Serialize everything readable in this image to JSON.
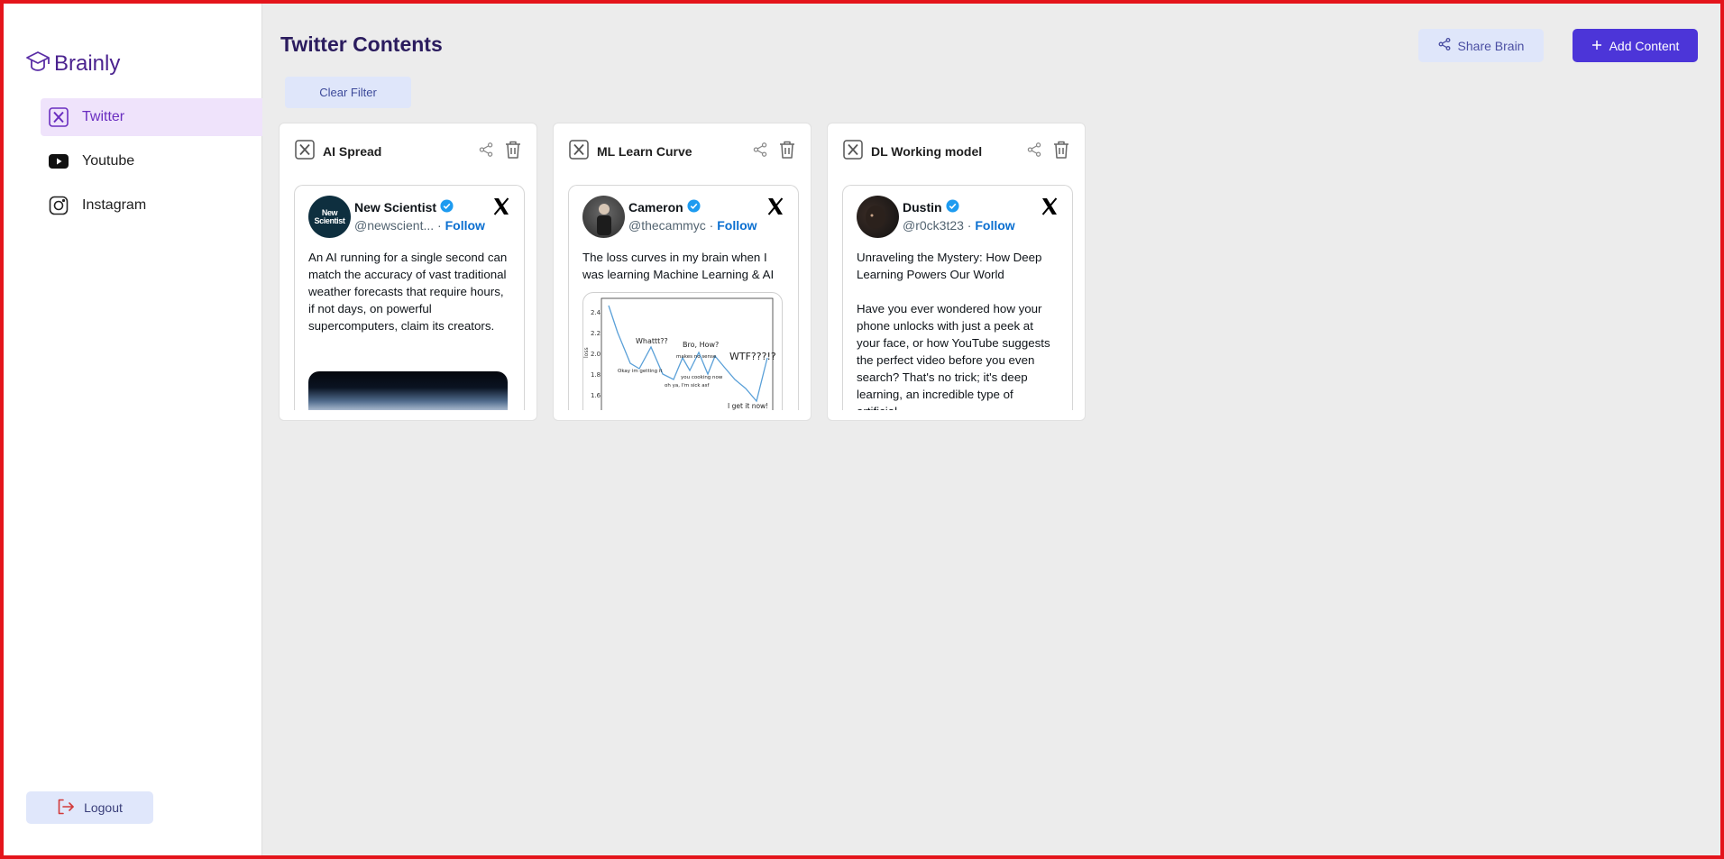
{
  "brand": {
    "name": "Brainly"
  },
  "sidebar": {
    "items": [
      {
        "label": "Twitter",
        "icon": "x-logo-icon"
      },
      {
        "label": "Youtube",
        "icon": "youtube-icon"
      },
      {
        "label": "Instagram",
        "icon": "instagram-icon"
      }
    ],
    "logout_label": "Logout"
  },
  "header": {
    "title": "Twitter Contents",
    "share_label": "Share Brain",
    "add_label": "Add Content",
    "clear_filter_label": "Clear Filter"
  },
  "colors": {
    "accent": "#4c35d8",
    "active_nav_bg": "#efe3fb",
    "active_nav_text": "#6a2ec0",
    "border": "#e4141b"
  },
  "cards": [
    {
      "title": "AI Spread",
      "author": "New Scientist",
      "handle": "@newscient...",
      "follow": "Follow",
      "avatar_text": "New Scientist",
      "text": "An AI running for a single second can match the accuracy of vast traditional weather forecasts that require hours, if not days, on powerful supercomputers, claim its creators."
    },
    {
      "title": "ML Learn Curve",
      "author": "Cameron",
      "handle": "@thecammyc",
      "follow": "Follow",
      "text": "The loss curves in my brain when I was learning Machine Learning & AI",
      "chart_labels": {
        "ylabel": "loss",
        "yticks": [
          "2.4",
          "2.2",
          "2.0",
          "1.8",
          "1.6"
        ],
        "annotations": [
          "Whattt??",
          "Bro, How?",
          "WTF???!?",
          "makes no sense",
          "Okay im getting it",
          "you cooking now",
          "oh ya, I'm sick asf",
          "I get it now!"
        ]
      }
    },
    {
      "title": "DL Working model",
      "author": "Dustin",
      "handle": "@r0ck3t23",
      "follow": "Follow",
      "text": "Unraveling the Mystery: How Deep Learning Powers Our World\n\nHave you ever wondered how your phone unlocks with just a peek at your face, or how YouTube suggests the perfect video before you even search? That's no trick; it's deep learning, an incredible type of artificial..."
    }
  ]
}
